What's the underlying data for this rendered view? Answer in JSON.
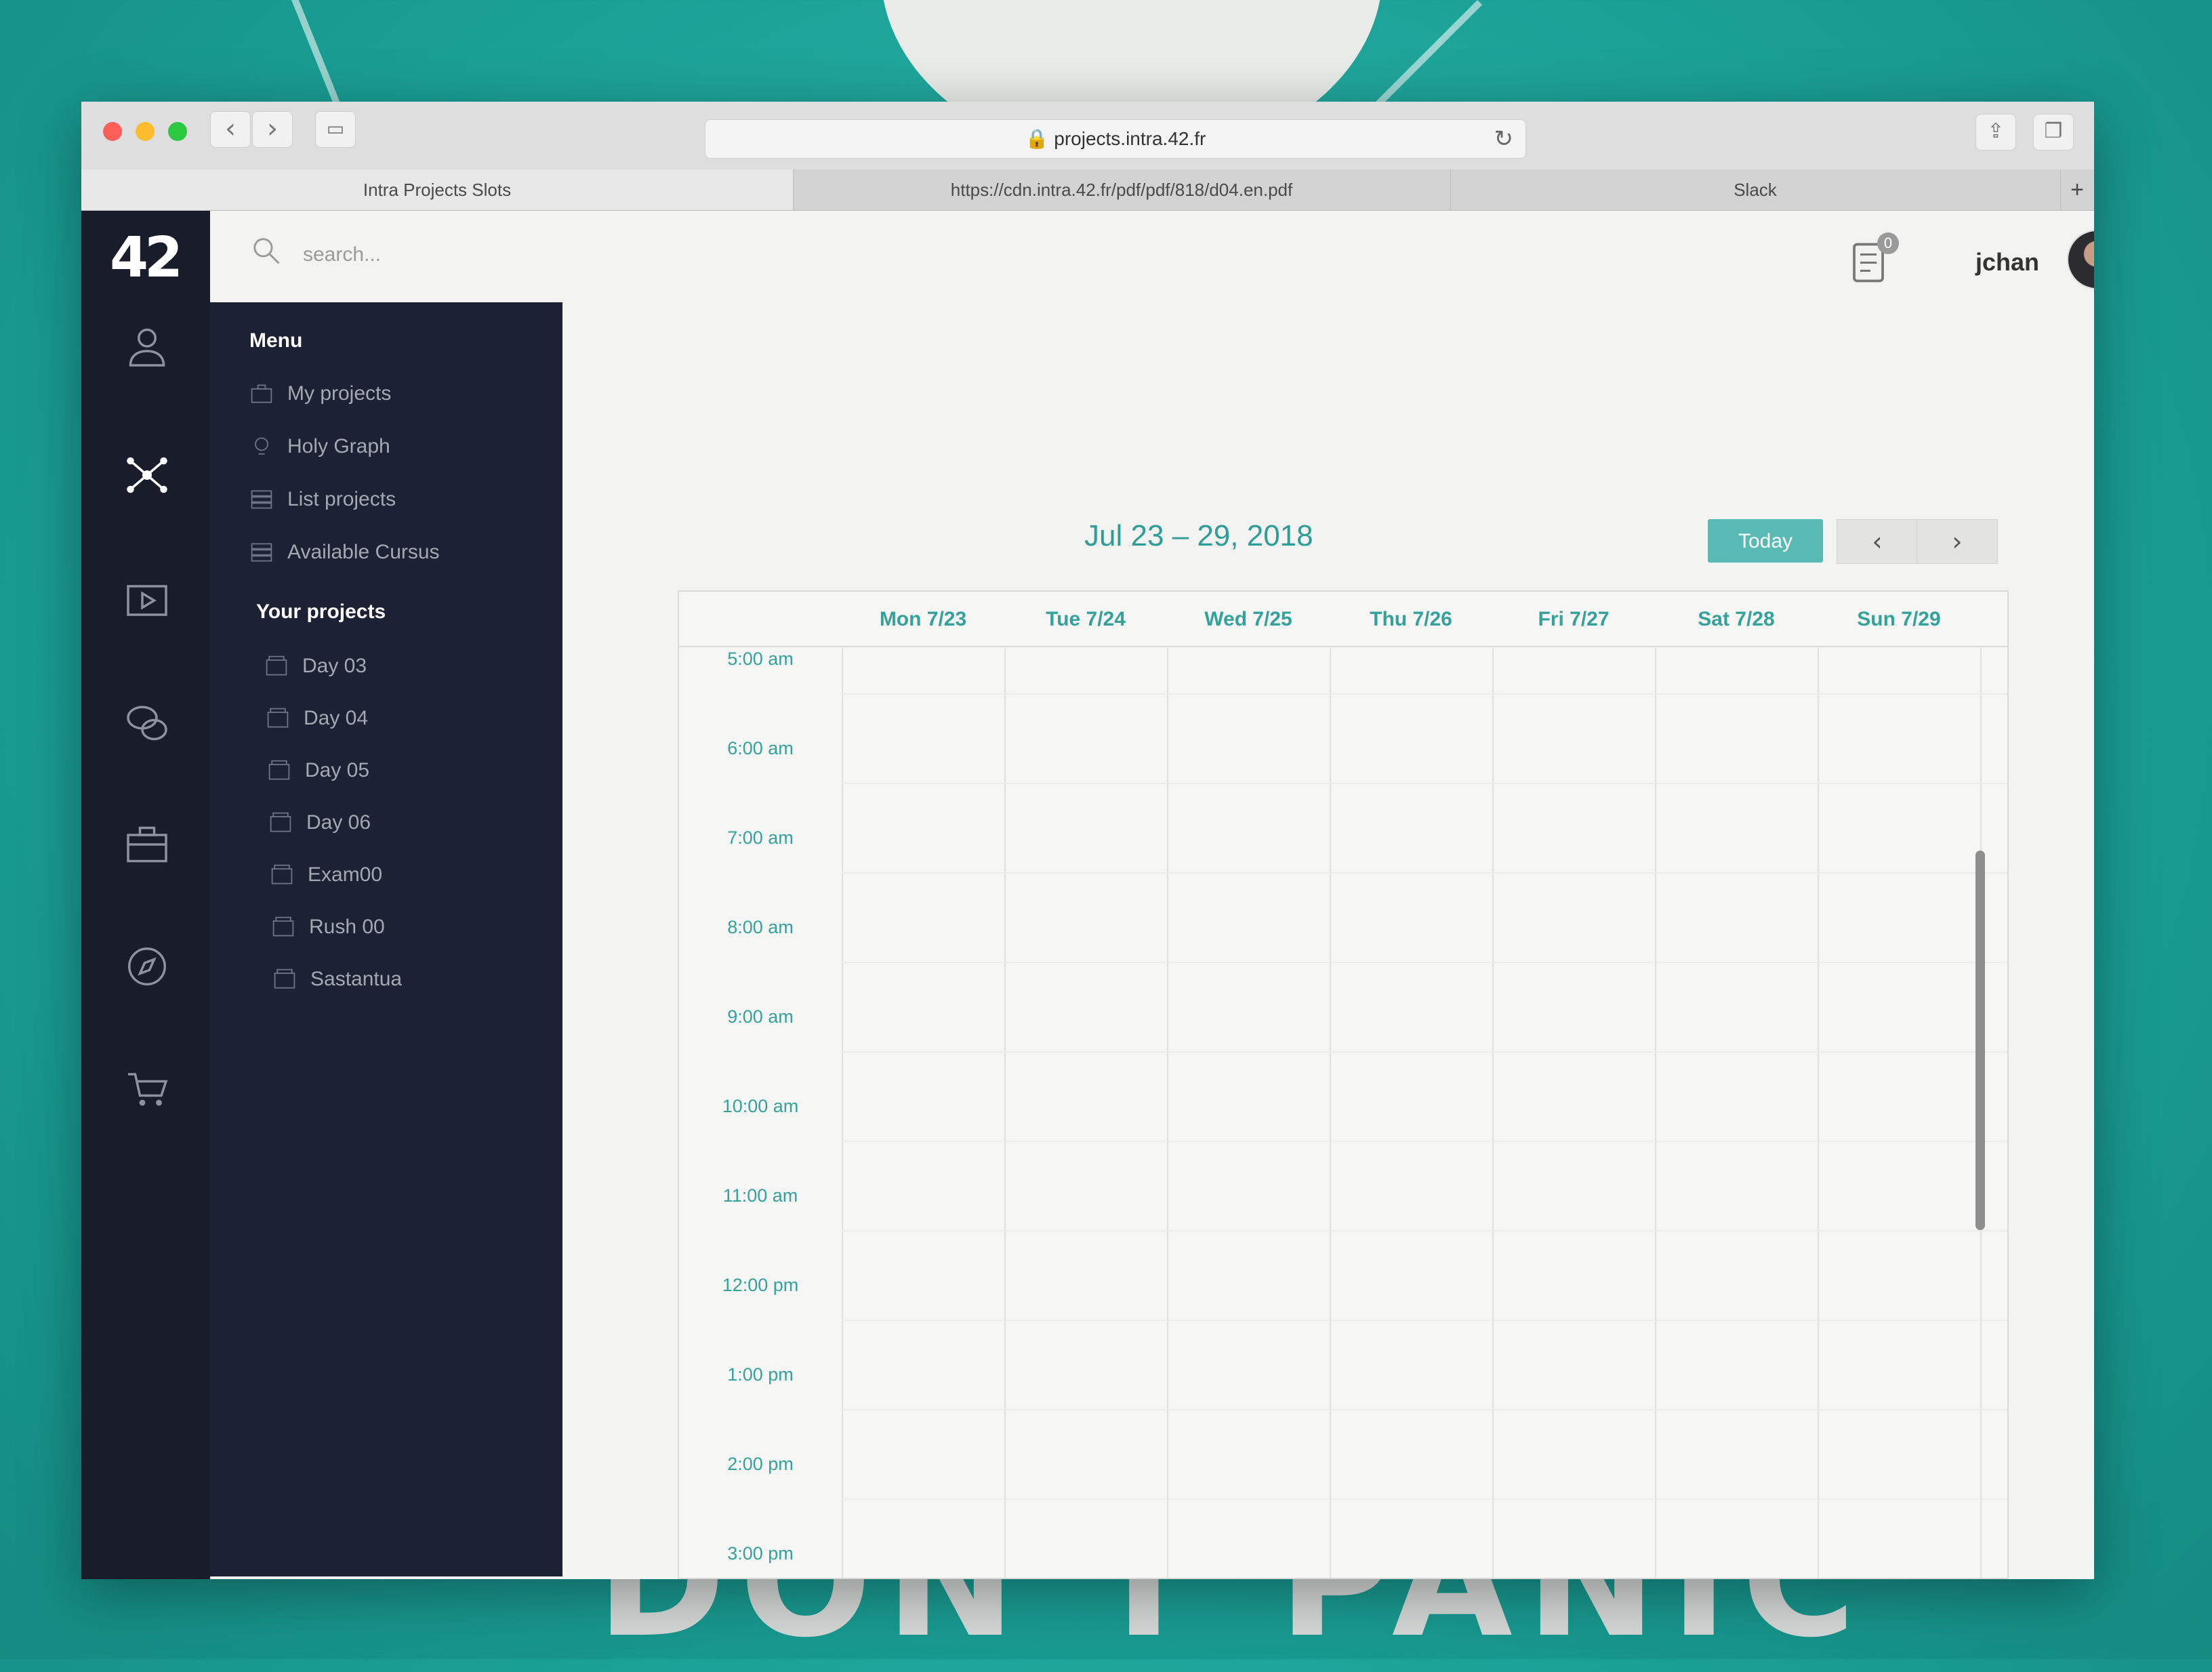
{
  "browser": {
    "url": "projects.intra.42.fr",
    "tabs": [
      "Intra Projects Slots",
      "https://cdn.intra.42.fr/pdf/pdf/818/d04.en.pdf",
      "Slack"
    ]
  },
  "app": {
    "logo": "42",
    "search": {
      "placeholder": "search..."
    },
    "notifications_count": "0",
    "username": "jchan"
  },
  "sidebar": {
    "menu_title": "Menu",
    "menu_items": [
      "My projects",
      "Holy Graph",
      "List projects",
      "Available Cursus"
    ],
    "projects_title": "Your projects",
    "projects": [
      "Day 03",
      "Day 04",
      "Day 05",
      "Day 06",
      "Exam00",
      "Rush 00",
      "Sastantua"
    ]
  },
  "calendar": {
    "range": "Jul 23 – 29, 2018",
    "today_label": "Today",
    "prev_label": "‹",
    "next_label": "›",
    "days": [
      "Mon 7/23",
      "Tue 7/24",
      "Wed 7/25",
      "Thu 7/26",
      "Fri 7/27",
      "Sat 7/28",
      "Sun 7/29"
    ],
    "times": [
      "5:00 am",
      "6:00 am",
      "7:00 am",
      "8:00 am",
      "9:00 am",
      "10:00 am",
      "11:00 am",
      "12:00 pm",
      "1:00 pm",
      "2:00 pm",
      "3:00 pm"
    ]
  },
  "colors": {
    "accent": "#34a29b",
    "sidebar": "#1c2233",
    "rail": "#181c2b"
  },
  "backdrop_text": "DON'T PANIC"
}
